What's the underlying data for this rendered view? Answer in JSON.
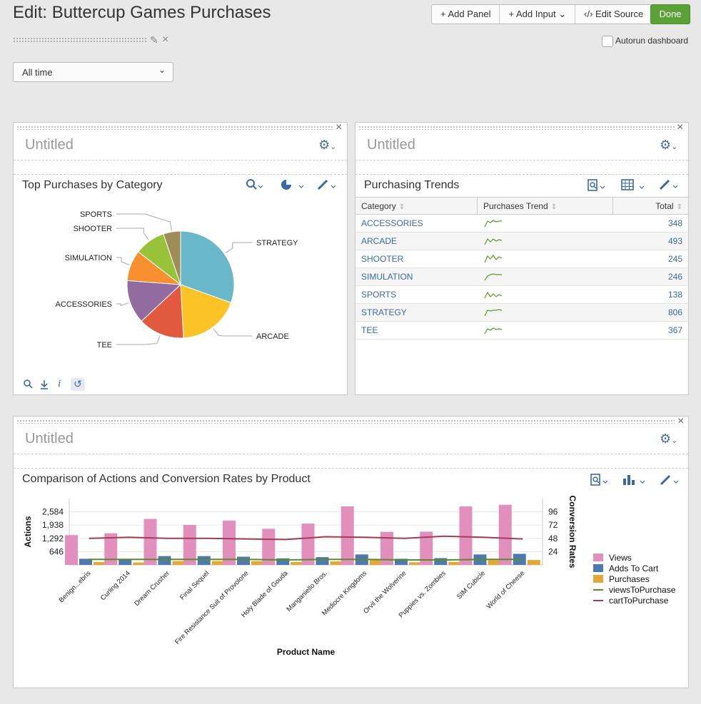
{
  "header": {
    "title": "Edit: Buttercup Games Purchases",
    "buttons": {
      "add_panel": "+ Add Panel",
      "add_input": "+ Add Input ⌄",
      "edit_source": "‹/› Edit Source",
      "done": "Done"
    },
    "autorun_label": "Autorun dashboard"
  },
  "time_picker": {
    "value": "All time"
  },
  "panel1": {
    "title": "Untitled",
    "viz_title": "Top Purchases by Category",
    "chart_data": {
      "type": "pie",
      "categories": [
        "STRATEGY",
        "ARCADE",
        "TEE",
        "ACCESSORIES",
        "SIMULATION",
        "SHOOTER",
        "SPORTS"
      ],
      "values": [
        806,
        493,
        367,
        348,
        246,
        245,
        138
      ],
      "colors": [
        "#6ab7c9",
        "#fbc325",
        "#e1593e",
        "#936c9f",
        "#f88f30",
        "#99c23b",
        "#a08c58"
      ]
    }
  },
  "panel2": {
    "title": "Untitled",
    "viz_title": "Purchasing Trends",
    "columns": [
      "Category",
      "Purchases Trend",
      "Total"
    ],
    "rows": [
      {
        "category": "ACCESSORIES",
        "total": "348"
      },
      {
        "category": "ARCADE",
        "total": "493"
      },
      {
        "category": "SHOOTER",
        "total": "245"
      },
      {
        "category": "SIMULATION",
        "total": "246"
      },
      {
        "category": "SPORTS",
        "total": "138"
      },
      {
        "category": "STRATEGY",
        "total": "806"
      },
      {
        "category": "TEE",
        "total": "367"
      }
    ]
  },
  "panel3": {
    "title": "Untitled",
    "viz_title": "Comparison of Actions and Conversion Rates by Product",
    "chart_data": {
      "type": "bar",
      "categories": [
        "Benign...ebris",
        "Curling 2014",
        "Dream Crusher",
        "Final Sequel",
        "Fire Resistance Suit of Provolone",
        "Holy Blade of Gouda",
        "Manganiello Bros.",
        "Mediocre Kingdoms",
        "Orvil the Wolverine",
        "Puppies vs. Zombies",
        "SIM Cubicle",
        "World of Cheese"
      ],
      "series": [
        {
          "name": "Views",
          "type": "bar",
          "axis": "left",
          "color": "#e38fbd",
          "values": [
            1450,
            1540,
            2240,
            1950,
            2160,
            1760,
            2010,
            2850,
            1610,
            1620,
            2850,
            2930
          ]
        },
        {
          "name": "Adds To Cart",
          "type": "bar",
          "axis": "left",
          "color": "#4e79b0",
          "values": [
            300,
            250,
            430,
            430,
            400,
            320,
            380,
            510,
            300,
            330,
            510,
            540
          ]
        },
        {
          "name": "Purchases",
          "type": "bar",
          "axis": "left",
          "color": "#e3a835",
          "values": [
            140,
            120,
            190,
            190,
            180,
            140,
            170,
            230,
            130,
            140,
            230,
            240
          ]
        },
        {
          "name": "viewsToPurchase",
          "type": "line",
          "axis": "right",
          "color": "#5a8a2a",
          "values": [
            10,
            10,
            10,
            10,
            10,
            9,
            10,
            10,
            9,
            9,
            10,
            10
          ]
        },
        {
          "name": "cartToPurchase",
          "type": "line",
          "axis": "right",
          "color": "#a23d55",
          "values": [
            48,
            50,
            48,
            48,
            47,
            46,
            51,
            50,
            48,
            52,
            50,
            47
          ]
        }
      ],
      "xlabel": "Product Name",
      "ylabel": "Actions",
      "y2label": "Conversion Rates",
      "y_ticks": [
        "646",
        "1,292",
        "1,938",
        "2,584"
      ],
      "y2_ticks": [
        "24",
        "48",
        "72",
        "96"
      ],
      "ylim": [
        0,
        3230
      ],
      "y2lim": [
        0,
        120
      ]
    }
  }
}
